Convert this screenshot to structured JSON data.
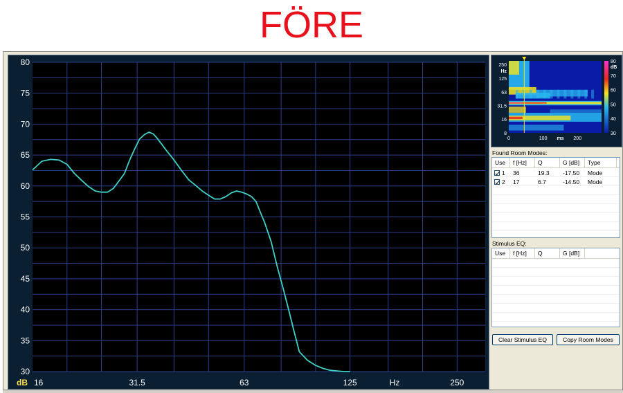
{
  "banner": {
    "title": "FÖRE"
  },
  "main_plot": {
    "y_unit": "dB",
    "y_ticks": [
      "80",
      "75",
      "70",
      "65",
      "60",
      "55",
      "50",
      "45",
      "40",
      "35",
      "30"
    ],
    "x_ticks": [
      "16",
      "31.5",
      "63",
      "125",
      "250"
    ],
    "x_unit": "Hz",
    "colors": {
      "background": "#000000",
      "grid": "#2b3f8c",
      "curve": "#3fd0c8",
      "frame": "#0b1f33",
      "tick_text": "#ffffff",
      "unit_text": "#ffe14a"
    }
  },
  "chart_data": {
    "type": "line",
    "title": "",
    "xlabel": "Hz",
    "ylabel": "dB",
    "x_scale": "log",
    "xlim": [
      16,
      300
    ],
    "ylim": [
      30,
      80
    ],
    "grid": true,
    "series": [
      {
        "x": [
          16,
          17,
          18,
          19,
          20,
          21,
          22,
          23,
          24,
          25,
          26,
          27,
          28,
          29,
          30,
          31,
          32,
          33,
          34,
          35,
          36,
          38,
          40,
          42,
          44,
          46,
          48,
          50,
          52,
          54,
          56,
          58,
          60,
          62,
          64,
          66,
          68,
          70,
          72,
          75,
          78,
          81,
          84,
          87,
          90,
          95,
          100,
          105,
          110,
          115,
          120,
          125
        ],
        "y": [
          62.6,
          64.0,
          64.3,
          64.2,
          63.5,
          62.0,
          60.9,
          59.9,
          59.2,
          59.0,
          59.0,
          59.6,
          60.8,
          62.0,
          64.2,
          66.0,
          67.6,
          68.3,
          68.7,
          68.4,
          67.6,
          65.8,
          64.2,
          62.5,
          61.0,
          60.1,
          59.2,
          58.5,
          57.9,
          57.9,
          58.3,
          58.9,
          59.2,
          59.0,
          58.7,
          58.3,
          57.5,
          55.7,
          54.0,
          51.0,
          47.0,
          43.5,
          40.0,
          36.5,
          33.2,
          31.8,
          31.0,
          30.5,
          30.2,
          30.1,
          30.0,
          30.0
        ]
      }
    ]
  },
  "spectrogram": {
    "y_unit": "Hz",
    "y_ticks": [
      "250",
      "125",
      "63",
      "31.5",
      "16",
      "8"
    ],
    "x_ticks": [
      "0",
      "100",
      "200"
    ],
    "x_unit": "ms",
    "scale_unit": "dB",
    "scale_ticks": [
      "80",
      "70",
      "60",
      "50",
      "40",
      "30"
    ],
    "colors": {
      "cold": "#0a1ba8",
      "mid": "#28b8f0",
      "warm": "#f5e51a",
      "hot": "#f0271e",
      "peak": "#ff2fd0",
      "marker": "#f5e51a"
    }
  },
  "found_modes": {
    "label": "Found Room Modes:",
    "columns": [
      "Use",
      "f [Hz]",
      "Q",
      "G [dB]",
      "Type"
    ],
    "rows": [
      {
        "use": "1",
        "f": "36",
        "q": "19.3",
        "g": "-17.50",
        "type": "Mode"
      },
      {
        "use": "2",
        "f": "17",
        "q": "6.7",
        "g": "-14.50",
        "type": "Mode"
      }
    ]
  },
  "stimulus_eq": {
    "label": "Stimulus EQ:",
    "columns": [
      "Use",
      "f [Hz]",
      "Q",
      "G [dB]"
    ]
  },
  "buttons": {
    "clear_stimulus": "Clear Stimulus EQ",
    "copy_modes": "Copy Room Modes"
  },
  "resize_arrow": "▸"
}
